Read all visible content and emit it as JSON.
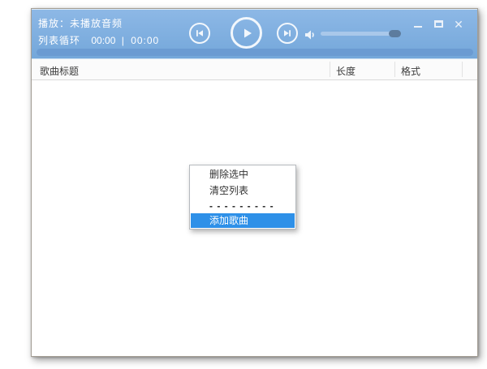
{
  "titlebar": {
    "now_playing": "播放：未播放音频",
    "play_mode": "列表循环",
    "time_elapsed": "00:00",
    "time_divider": "|",
    "time_total": "00:00"
  },
  "icons": {
    "close_glyph": "✕"
  },
  "table": {
    "columns": [
      {
        "label": "歌曲标题"
      },
      {
        "label": "长度"
      },
      {
        "label": "格式"
      }
    ]
  },
  "context_menu": {
    "items": [
      {
        "label": "删除选中",
        "type": "item"
      },
      {
        "label": "清空列表",
        "type": "item"
      },
      {
        "label": "- - - - - - - - -",
        "type": "separator"
      },
      {
        "label": "添加歌曲",
        "type": "item",
        "highlighted": true
      }
    ]
  },
  "colors": {
    "titlebar_blue": "#7fadde",
    "progress_track": "#6b9bd2",
    "volume_thumb": "#5d7c9e",
    "menu_highlight": "#2e90e8"
  }
}
